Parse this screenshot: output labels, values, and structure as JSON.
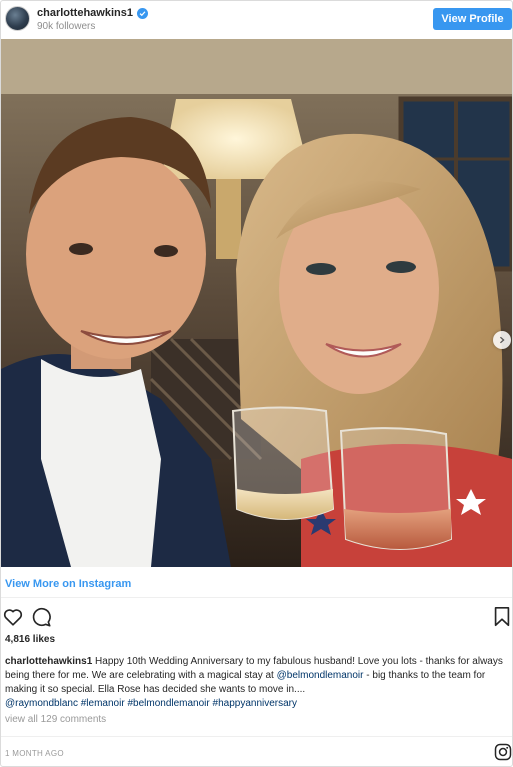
{
  "header": {
    "username": "charlottehawkins1",
    "followers": "90k followers",
    "view_profile_label": "View Profile"
  },
  "photo": {
    "description_icon": "photo-next-arrow-icon"
  },
  "view_more_label": "View More on Instagram",
  "actions": {
    "like_icon": "heart-icon",
    "comment_icon": "comment-icon",
    "save_icon": "bookmark-icon"
  },
  "likes": "4,816 likes",
  "caption": {
    "username": "charlottehawkins1",
    "text_1": " Happy 10th Wedding Anniversary to my fabulous husband! Love you lots - thanks for always being there for me. We are celebrating with a magical stay at ",
    "tag_1": "@belmondlemanoir",
    "text_2": " - big thanks to the team for making it so special. Ella Rose has decided she wants to move in....",
    "tag_2": "@raymondblanc",
    "tag_3": "#lemanoir",
    "tag_4": "#belmondlemanoir",
    "tag_5": "#happyanniversary"
  },
  "comments_label": "view all 129 comments",
  "timestamp": "1 MONTH AGO",
  "colors": {
    "accent": "#3897f0",
    "hashtag": "#003569",
    "muted": "#999999"
  }
}
